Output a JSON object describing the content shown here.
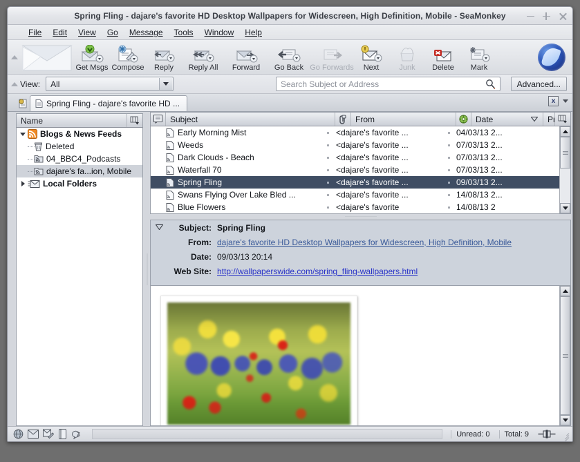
{
  "window": {
    "title": "Spring Fling - dajare's favorite HD Desktop Wallpapers for Widescreen, High Definition, Mobile - SeaMonkey",
    "minimize_label": "−",
    "maximize_label": "+",
    "close_label": "×"
  },
  "menubar": {
    "items": [
      {
        "label": "File"
      },
      {
        "label": "Edit"
      },
      {
        "label": "View"
      },
      {
        "label": "Go"
      },
      {
        "label": "Message"
      },
      {
        "label": "Tools"
      },
      {
        "label": "Window"
      },
      {
        "label": "Help"
      }
    ]
  },
  "toolbar": {
    "buttons": [
      {
        "label": "Get Msgs",
        "icon": "get-messages-icon",
        "disabled": false
      },
      {
        "label": "Compose",
        "icon": "compose-icon",
        "disabled": false
      },
      {
        "label": "Reply",
        "icon": "reply-icon",
        "disabled": false
      },
      {
        "label": "Reply All",
        "icon": "reply-all-icon",
        "disabled": false
      },
      {
        "label": "Forward",
        "icon": "forward-icon",
        "disabled": false
      },
      {
        "label": "Go Back",
        "icon": "go-back-icon",
        "disabled": false
      },
      {
        "label": "Go Forwards",
        "icon": "go-forwards-icon",
        "disabled": true
      },
      {
        "label": "Next",
        "icon": "next-icon",
        "disabled": false
      },
      {
        "label": "Junk",
        "icon": "junk-icon",
        "disabled": true
      },
      {
        "label": "Delete",
        "icon": "delete-icon",
        "disabled": false
      },
      {
        "label": "Mark",
        "icon": "mark-icon",
        "disabled": false
      }
    ],
    "logo_icon": "seamonkey-logo-icon"
  },
  "searchbar": {
    "view_label": "View:",
    "view_value": "All",
    "search_placeholder": "Search Subject or Address",
    "search_value": "",
    "advanced_label": "Advanced..."
  },
  "tabbar": {
    "tab_label": "Spring Fling - dajare's favorite HD ...",
    "close_label": "x"
  },
  "folder_pane": {
    "column_header": "Name",
    "items": [
      {
        "label": "Blogs & News Feeds",
        "icon": "feed-icon",
        "depth": 0,
        "twisty": "open",
        "bold": true,
        "selected": false
      },
      {
        "label": "Deleted",
        "icon": "trash-icon",
        "depth": 1,
        "twisty": "none",
        "bold": false,
        "selected": false
      },
      {
        "label": "04_BBC4_Podcasts",
        "icon": "feed-folder-icon",
        "depth": 1,
        "twisty": "none",
        "bold": false,
        "selected": false
      },
      {
        "label": "dajare's fa...ion, Mobile",
        "icon": "feed-folder-icon",
        "depth": 1,
        "twisty": "none",
        "bold": false,
        "selected": true
      },
      {
        "label": "Local Folders",
        "icon": "local-folders-icon",
        "depth": 0,
        "twisty": "closed",
        "bold": true,
        "selected": false
      }
    ]
  },
  "message_list": {
    "columns": [
      {
        "label": "",
        "icon": "thread-column-icon"
      },
      {
        "label": "Subject",
        "icon": ""
      },
      {
        "label": "",
        "icon": "attachment-column-icon"
      },
      {
        "label": "From",
        "icon": ""
      },
      {
        "label": "",
        "icon": "junk-column-icon"
      },
      {
        "label": "Date",
        "icon": "sort-descending-icon"
      },
      {
        "label": "Priority",
        "icon": ""
      },
      {
        "label": "",
        "icon": "column-picker-icon"
      }
    ],
    "rows": [
      {
        "subject": "Early Morning Mist",
        "from": "<dajare's favorite ...",
        "date": "04/03/13 2...",
        "priority": "",
        "selected": false
      },
      {
        "subject": "Weeds",
        "from": "<dajare's favorite ...",
        "date": "07/03/13 2...",
        "priority": "",
        "selected": false
      },
      {
        "subject": "Dark Clouds - Beach",
        "from": "<dajare's favorite ...",
        "date": "07/03/13 2...",
        "priority": "",
        "selected": false
      },
      {
        "subject": "Waterfall 70",
        "from": "<dajare's favorite ...",
        "date": "07/03/13 2...",
        "priority": "",
        "selected": false
      },
      {
        "subject": "Spring Fling",
        "from": "<dajare's favorite ...",
        "date": "09/03/13 2...",
        "priority": "",
        "selected": true
      },
      {
        "subject": "Swans Flying Over Lake Bled ...",
        "from": "<dajare's favorite ...",
        "date": "14/08/13 2...",
        "priority": "",
        "selected": false
      },
      {
        "subject": "Blue Flowers",
        "from": "<dajare's favorite",
        "date": "14/08/13 2",
        "priority": "",
        "selected": false
      }
    ]
  },
  "message_header": {
    "fields": [
      {
        "key": "Subject:",
        "value": "Spring Fling",
        "style": "bold"
      },
      {
        "key": "From:",
        "value": "dajare's favorite HD Desktop Wallpapers for Widescreen, High Definition, Mobile",
        "style": "linkgrey"
      },
      {
        "key": "Date:",
        "value": "09/03/13 20:14",
        "style": "plain"
      },
      {
        "key": "Web Site:",
        "value": "http://wallpaperswide.com/spring_fling-wallpapers.html",
        "style": "linkblue"
      }
    ],
    "twisty_icon": "collapse-header-icon"
  },
  "message_body": {
    "image_alt": "Spring meadow wallpaper with yellow, blue and red flowers"
  },
  "statusbar": {
    "icons": [
      {
        "name": "globe-icon"
      },
      {
        "name": "mail-icon"
      },
      {
        "name": "composer-icon"
      },
      {
        "name": "addressbook-icon"
      },
      {
        "name": "chatzilla-icon"
      }
    ],
    "unread_label": "Unread: 0",
    "total_label": "Total: 9",
    "progress_icon": "progress-meter-icon"
  },
  "colors": {
    "selection": "#3f4d63",
    "tree_selection": "#cfd3da",
    "link_blue": "#2b35c8",
    "link_grey": "#3a5a99",
    "window_bg": "#d4d7dd",
    "desktop": "#6e6e6e"
  }
}
